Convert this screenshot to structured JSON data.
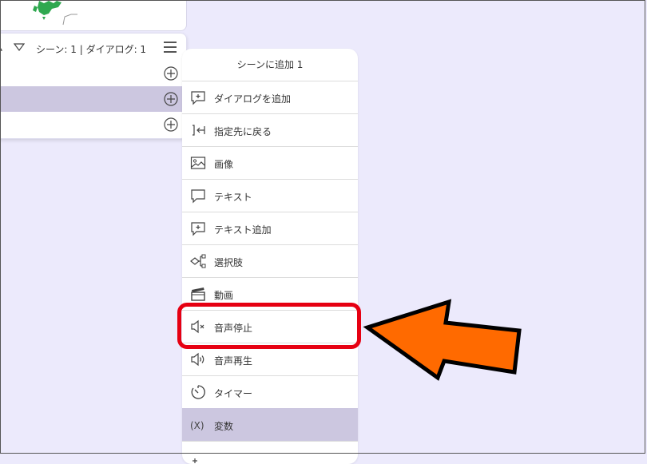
{
  "scene_panel": {
    "title": "シーン: 1 | ダイアログ: 1",
    "rows": [
      {
        "selected": false
      },
      {
        "selected": true
      },
      {
        "selected": false
      }
    ]
  },
  "menu": {
    "title": "シーンに追加 1",
    "items": [
      {
        "label": "ダイアログを追加",
        "icon": "dialog-add-icon"
      },
      {
        "label": "指定先に戻る",
        "icon": "return-to-icon"
      },
      {
        "label": "画像",
        "icon": "image-icon"
      },
      {
        "label": "テキスト",
        "icon": "text-bubble-icon"
      },
      {
        "label": "テキスト追加",
        "icon": "text-add-icon"
      },
      {
        "label": "選択肢",
        "icon": "choice-icon"
      },
      {
        "label": "動画",
        "icon": "video-clapper-icon"
      },
      {
        "label": "音声停止",
        "icon": "audio-stop-icon"
      },
      {
        "label": "音声再生",
        "icon": "audio-play-icon"
      },
      {
        "label": "タイマー",
        "icon": "timer-icon"
      },
      {
        "label": "変数",
        "icon": "variable-icon",
        "selected": true
      },
      {
        "label": "",
        "icon": "partial-item-icon"
      }
    ]
  },
  "colors": {
    "background": "#eceafc",
    "selected_row": "#ccc7e0",
    "highlight_box": "#e60012",
    "arrow": "#ff6a00",
    "map_green": "#2fa84f"
  }
}
